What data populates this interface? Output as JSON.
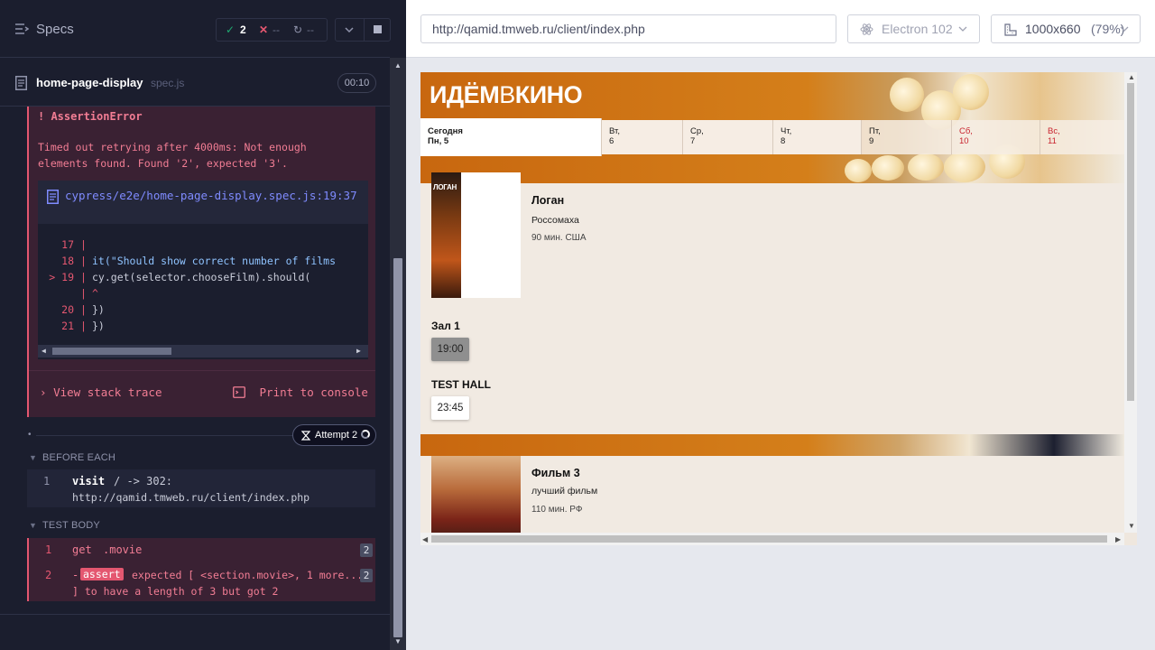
{
  "runner": {
    "header": {
      "title": "Specs",
      "passed_count": "2",
      "failed_count": "--",
      "pending_count": "--"
    },
    "spec": {
      "name": "home-page-display",
      "ext": "spec.js",
      "duration": "00:10"
    },
    "error": {
      "title": "! AssertionError",
      "message": "Timed out retrying after 4000ms: Not enough elements found. Found '2', expected '3'.",
      "file": "cypress/e2e/home-page-display.spec.js:19:37",
      "code_lines": [
        {
          "num": "17",
          "text": ""
        },
        {
          "num": "18",
          "text": "    it(\"Should show correct number of films"
        },
        {
          "num": "> 19",
          "text": "        cy.get(selector.chooseFilm).should("
        },
        {
          "num": "",
          "text": "                                       ^"
        },
        {
          "num": "20",
          "text": "    })"
        },
        {
          "num": "21",
          "text": "})"
        }
      ],
      "view_stack_trace": "View stack trace",
      "print_to_console": "Print to console"
    },
    "attempt_label": "Attempt 2",
    "before_each": {
      "label": "BEFORE EACH",
      "rows": [
        {
          "num": "1",
          "cmd": "visit",
          "detail": "/ -> 302:",
          "url": "http://qamid.tmweb.ru/client/index.php"
        }
      ]
    },
    "test_body": {
      "label": "TEST BODY",
      "rows": [
        {
          "num": "1",
          "cmd": "get",
          "detail": ".movie",
          "badge": "2"
        },
        {
          "num": "2",
          "cmd": "assert",
          "detail": "expected [ <section.movie>, 1 more...",
          "detail2": "] to have a length of 3 but got 2",
          "badge": "2"
        }
      ]
    }
  },
  "browser": {
    "url": "http://qamid.tmweb.ru/client/index.php",
    "browser_name": "Electron 102",
    "viewport": "1000x660",
    "zoom": "(79%)"
  },
  "site": {
    "logo": {
      "part1": "ИДЁМ",
      "part2": "В",
      "part3": "КИНО"
    },
    "days": [
      {
        "label": "Сегодня",
        "date": "Пн, 5",
        "active": true,
        "weekend": false
      },
      {
        "label": "Вт,",
        "date": "6",
        "active": false,
        "weekend": false
      },
      {
        "label": "Ср,",
        "date": "7",
        "active": false,
        "weekend": false
      },
      {
        "label": "Чт,",
        "date": "8",
        "active": false,
        "weekend": false
      },
      {
        "label": "Пт,",
        "date": "9",
        "active": false,
        "weekend": false
      },
      {
        "label": "Сб,",
        "date": "10",
        "active": false,
        "weekend": true
      },
      {
        "label": "Вс,",
        "date": "11",
        "active": false,
        "weekend": true
      }
    ],
    "movies": [
      {
        "title": "Логан",
        "synopsis": "Россомаха",
        "duration": "90 мин. США",
        "poster_text": "ЛОГАН",
        "halls": [
          {
            "name": "Зал 1",
            "times": [
              "19:00"
            ]
          },
          {
            "name": "TEST HALL",
            "times": [
              "23:45"
            ]
          }
        ]
      },
      {
        "title": "Фильм 3",
        "synopsis": "лучший фильм",
        "duration": "110 мин. РФ"
      }
    ]
  },
  "colors": {
    "accent_red": "#e45770",
    "passed_green": "#1fa971",
    "brand_orange": "#c8670f"
  }
}
